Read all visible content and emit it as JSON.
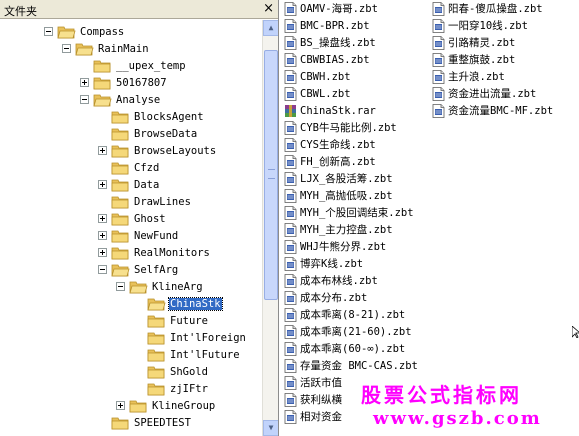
{
  "left_pane": {
    "title": "文件夹",
    "close_glyph": "×",
    "tree": [
      {
        "label": "Compass",
        "depth": 0,
        "toggle": "open"
      },
      {
        "label": "RainMain",
        "depth": 1,
        "toggle": "open"
      },
      {
        "label": "__upex_temp",
        "depth": 2,
        "toggle": "none"
      },
      {
        "label": "50167807",
        "depth": 2,
        "toggle": "closed"
      },
      {
        "label": "Analyse",
        "depth": 2,
        "toggle": "open"
      },
      {
        "label": "BlocksAgent",
        "depth": 3,
        "toggle": "none"
      },
      {
        "label": "BrowseData",
        "depth": 3,
        "toggle": "none"
      },
      {
        "label": "BrowseLayouts",
        "depth": 3,
        "toggle": "closed"
      },
      {
        "label": "Cfzd",
        "depth": 3,
        "toggle": "none"
      },
      {
        "label": "Data",
        "depth": 3,
        "toggle": "closed"
      },
      {
        "label": "DrawLines",
        "depth": 3,
        "toggle": "none"
      },
      {
        "label": "Ghost",
        "depth": 3,
        "toggle": "closed"
      },
      {
        "label": "NewFund",
        "depth": 3,
        "toggle": "closed"
      },
      {
        "label": "RealMonitors",
        "depth": 3,
        "toggle": "closed"
      },
      {
        "label": "SelfArg",
        "depth": 3,
        "toggle": "open"
      },
      {
        "label": "KlineArg",
        "depth": 4,
        "toggle": "open"
      },
      {
        "label": "ChinaStk",
        "depth": 5,
        "toggle": "none",
        "selected": true
      },
      {
        "label": "Future",
        "depth": 5,
        "toggle": "none"
      },
      {
        "label": "Int'lForeign",
        "depth": 5,
        "toggle": "none"
      },
      {
        "label": "Int'lFuture",
        "depth": 5,
        "toggle": "none"
      },
      {
        "label": "ShGold",
        "depth": 5,
        "toggle": "none"
      },
      {
        "label": "zjIFtr",
        "depth": 5,
        "toggle": "none"
      },
      {
        "label": "KlineGroup",
        "depth": 4,
        "toggle": "closed"
      },
      {
        "label": "SPEEDTEST",
        "depth": 3,
        "toggle": "none"
      }
    ],
    "scrollbar": {
      "up_glyph": "▲",
      "down_glyph": "▼"
    }
  },
  "files_col1": [
    {
      "name": "OAMV-海哥.zbt",
      "icon": "zbt"
    },
    {
      "name": "BMC-BPR.zbt",
      "icon": "zbt"
    },
    {
      "name": "BS_操盘线.zbt",
      "icon": "zbt"
    },
    {
      "name": "CBWBIAS.zbt",
      "icon": "zbt"
    },
    {
      "name": "CBWH.zbt",
      "icon": "zbt"
    },
    {
      "name": "CBWL.zbt",
      "icon": "zbt"
    },
    {
      "name": "ChinaStk.rar",
      "icon": "rar"
    },
    {
      "name": "CYB牛马能比例.zbt",
      "icon": "zbt"
    },
    {
      "name": "CYS生命线.zbt",
      "icon": "zbt"
    },
    {
      "name": "FH_创新高.zbt",
      "icon": "zbt"
    },
    {
      "name": "LJX_各股活筹.zbt",
      "icon": "zbt"
    },
    {
      "name": "MYH_高抛低吸.zbt",
      "icon": "zbt"
    },
    {
      "name": "MYH_个股回调结束.zbt",
      "icon": "zbt"
    },
    {
      "name": "MYH_主力控盘.zbt",
      "icon": "zbt"
    },
    {
      "name": "WHJ牛熊分界.zbt",
      "icon": "zbt"
    },
    {
      "name": "博弈K线.zbt",
      "icon": "zbt"
    },
    {
      "name": "成本布林线.zbt",
      "icon": "zbt"
    },
    {
      "name": "成本分布.zbt",
      "icon": "zbt"
    },
    {
      "name": "成本乖离(8-21).zbt",
      "icon": "zbt"
    },
    {
      "name": "成本乖离(21-60).zbt",
      "icon": "zbt"
    },
    {
      "name": "成本乖离(60-∞).zbt",
      "icon": "zbt"
    },
    {
      "name": "存量资金 BMC-CAS.zbt",
      "icon": "zbt"
    },
    {
      "name": "活跃市值",
      "icon": "zbt"
    },
    {
      "name": "获利纵横",
      "icon": "zbt"
    },
    {
      "name": "相对资金",
      "icon": "zbt"
    }
  ],
  "files_col2": [
    {
      "name": "阳春-傻瓜操盘.zbt",
      "icon": "zbt"
    },
    {
      "name": "一阳穿10线.zbt",
      "icon": "zbt"
    },
    {
      "name": "引路精灵.zbt",
      "icon": "zbt"
    },
    {
      "name": "重整旗鼓.zbt",
      "icon": "zbt"
    },
    {
      "name": "主升浪.zbt",
      "icon": "zbt"
    },
    {
      "name": "资金进出流量.zbt",
      "icon": "zbt"
    },
    {
      "name": "资金流量BMC-MF.zbt",
      "icon": "zbt"
    }
  ],
  "watermark": {
    "title": "股票公式指标网",
    "url": "www.gszb.com",
    "color": "#ff00ff"
  },
  "colors": {
    "selection": "#316ac5",
    "folder": "#f2d27a",
    "toolbar": "#ece9d8"
  }
}
